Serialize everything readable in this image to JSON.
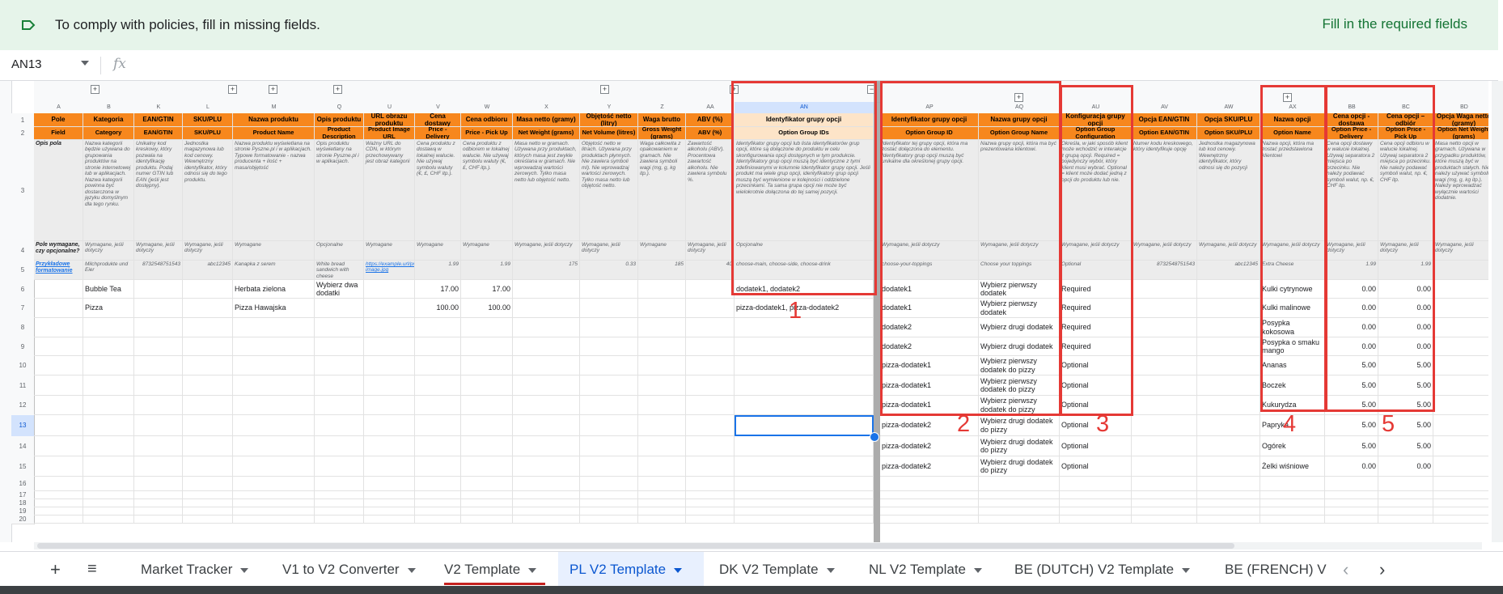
{
  "banner": {
    "message": "To comply with policies, fill in missing fields.",
    "action": "Fill in the required fields"
  },
  "formula_bar": {
    "cell_ref": "AN13",
    "fx": "fx"
  },
  "colors": {
    "header_orange": "#f7871d",
    "header_peach": "#fde4c8",
    "annotation_red": "#e53935",
    "selection_blue": "#1a73e8"
  },
  "row_numbers": [
    "1",
    "2",
    "3",
    "4",
    "5",
    "6",
    "7",
    "8",
    "9",
    "10",
    "11",
    "12",
    "13",
    "14",
    "15",
    "16",
    "17",
    "18",
    "19",
    "20"
  ],
  "columns": [
    {
      "letter": "A",
      "row1": "Pole",
      "row2": "Field",
      "row3": "Opis pola",
      "row4": "Pole wymagane, czy opcjonalne?",
      "row5": "Przykładowe formatowanie"
    },
    {
      "letter": "B",
      "row1": "Kategoria",
      "row2": "Category",
      "row3": "Nazwa kategorii będzie używana do grupowania produktów na stronie internetowej lub w aplikacjach. Nazwa kategorii powinna być dostarczona w języku domyślnym dla tego rynku.",
      "row4": "Wymagane, jeśli dotyczy",
      "row5": "Milchprodukte und Eier"
    },
    {
      "letter": "K",
      "row1": "EAN/GTIN",
      "row2": "EAN/GTIN",
      "row3": "Unikalny kod kreskowy, który pozwala na identyfikację produktu. Podaj numer GTIN lub EAN (jeśli jest dostępny).",
      "row4": "Wymagane, jeśli dotyczy",
      "row5": "8732548751543"
    },
    {
      "letter": "L",
      "row1": "SKU/PLU",
      "row2": "SKU/PLU",
      "row3": "Jednostka magazynowa lub kod cenowy. Wewnętrzny identyfikator, który odnosi się do tego produktu.",
      "row4": "Wymagane, jeśli dotyczy",
      "row5": "abc12345"
    },
    {
      "letter": "M",
      "row1": "Nazwa produktu",
      "row2": "Product Name",
      "row3": "Nazwa produktu wyświetlana na stronie Pyszne.pl i w aplikacjach. Typowe formatowanie - nazwa producenta + ilość + masa/objętość",
      "row4": "Wymagane",
      "row5": "Kanapka z serem"
    },
    {
      "letter": "Q",
      "row1": "Opis produktu",
      "row2": "Product Description",
      "row3": "Opis produktu wyświetlany na stronie Pyszne.pl i w aplikacjach.",
      "row4": "Opcjonalne",
      "row5": "White bread sandwich with cheese"
    },
    {
      "letter": "U",
      "row1": "URL obrazu produktu",
      "row2": "Product Image URL",
      "row3": "Ważny URL do CDN, w którym przechowywany jest obraz kategorii",
      "row4": "Wymagane",
      "row5": "https://example.url/product/product-image.jpg"
    },
    {
      "letter": "V",
      "row1": "Cena dostawy",
      "row2": "Price - Delivery",
      "row3": "Cena produktu z dostawą w lokalnej walucie. Nie używaj symbolu waluty (€, £, CHF itp.).",
      "row4": "Wymagane",
      "row5": "1.99"
    },
    {
      "letter": "W",
      "row1": "Cena odbioru",
      "row2": "Price - Pick Up",
      "row3": "Cena produktu z odbiorem w lokalnej walucie. Nie używaj symbolu waluty (€, £, CHF itp.).",
      "row4": "Wymagane",
      "row5": "1.99"
    },
    {
      "letter": "X",
      "row1": "Masa netto (gramy)",
      "row2": "Net Weight (grams)",
      "row3": "Masa netto w gramach. Używana przy produktach, których masa jest zwykle określana w gramach. Nie wprowadzaj wartości zerowych. Tylko masa netto lub objętość netto.",
      "row4": "Wymagane, jeśli dotyczy",
      "row5": "175"
    },
    {
      "letter": "Y",
      "row1": "Objętość netto (litry)",
      "row2": "Net Volume (litres)",
      "row3": "Objętość netto w litrach. Używana przy produktach płynnych. Nie zawiera symboli ml). Nie wprowadzaj wartości zerowych. Tylko masa netto lub objętość netto.",
      "row4": "Wymagane, jeśli dotyczy",
      "row5": "0.33"
    },
    {
      "letter": "Z",
      "row1": "Waga brutto",
      "row2": "Gross Weight (grams)",
      "row3": "Waga całkowita z opakowaniem w gramach. Nie zawiera symboli wagi (mg, g, kg itp.).",
      "row4": "Wymagane",
      "row5": "185"
    },
    {
      "letter": "AA",
      "row1": "ABV (%)",
      "row2": "ABV (%)",
      "row3": "Zawartość alkoholu (ABV). Procentowa zawartość alkoholu. Nie zawiera symbolu %.",
      "row4": "Wymagane, jeśli dotyczy",
      "row5": "40"
    },
    {
      "letter": "AN",
      "row1": "Identyfikator grupy opcji",
      "row2": "Option Group IDs",
      "row3": "Identyfikator grupy opcji lub listа identyfikatorów grup opcji, które są dołączone do produktu w celu skonfigurowania opcji dostępnych w tym produkcie. Identyfikatory grup opcji muszą być identyczne z tymi zdefiniowanymi w kolumnie Identyfikator grupy opcji. Jeśli produkt ma wiele grup opcji, identyfikatory grup opcji muszą być wymienione w kolejności i oddzielone przecinkami. Ta sama grupa opcji nie może być wielokrotnie dołączona do tej samej pozycji.",
      "row4": "Opcjonalne",
      "row5": "choose-main, choose-side, choose-drink"
    },
    {
      "letter": "AP",
      "row1": "Identyfikator grupy opcji",
      "row2": "Option Group ID",
      "row3": "Identyfikator tej grupy opcji, która ma zostać dołączona do elementu. Identyfikatory grup opcji muszą być unikalne dla określonej grupy opcji.",
      "row4": "Wymagane, jeśli dotyczy",
      "row5": "choose-your-toppings"
    },
    {
      "letter": "AQ",
      "row1": "Nazwa grupy opcji",
      "row2": "Option Group Name",
      "row3": "Nazwa grupy opcji, która ma być prezentowana klientowi.",
      "row4": "Wymagane, jeśli dotyczy",
      "row5": "Choose your toppings"
    },
    {
      "letter": "AU",
      "row1": "Konfiguracja grupy opcji",
      "row2": "Option Group Configuration",
      "row3": "Określa, w jaki sposób klient może wchodzić w interakcje z grupą opcji. Required = pojedynczy wybór, który klient musi wybrać. Optional = klient może dodać jedną z opcji do produktu lub nie.",
      "row4": "Wymagane, jeśli dotyczy",
      "row5": "Optional"
    },
    {
      "letter": "AV",
      "row1": "Opcja EAN/GTIN",
      "row2": "Option EAN/GTIN",
      "row3": "Numer kodu kreskowego, który identyfikuje opcję",
      "row4": "Wymagane, jeśli dotyczy",
      "row5": "8732548751543"
    },
    {
      "letter": "AW",
      "row1": "Opcja SKU/PLU",
      "row2": "Option SKU/PLU",
      "row3": "Jednostka magazynowa lub kod cenowy. Wewnętrzny identyfikator, który odnosi się do pozycji",
      "row4": "Wymagane, jeśli dotyczy",
      "row5": "abc12345"
    },
    {
      "letter": "AX",
      "row1": "Nazwa opcji",
      "row2": "Option Name",
      "row3": "Nazwa opcji, która ma zostać przedstawiona klientowi",
      "row4": "Wymagane, jeśli dotyczy",
      "row5": "Extra Cheese"
    },
    {
      "letter": "BB",
      "row1": "Cena opcji - dostawa",
      "row2": "Option Price - Delivery",
      "row3": "Cena opcji dostawy w walucie lokalnej. Używaj separatora 2 miejsca po przecinku. Nie należy podawać symboli walut, np. €, CHF itp.",
      "row4": "Wymagane, jeśli dotyczy",
      "row5": "1.99"
    },
    {
      "letter": "BC",
      "row1": "Cena opcji – odbiór",
      "row2": "Option Price - Pick Up",
      "row3": "Cena opcji odbioru w walucie lokalnej. Używaj separatora 2 miejsca po przecinku. Nie należy podawać symboli walut, np. €, CHF itp.",
      "row4": "Wymagane, jeśli dotyczy",
      "row5": "1.99"
    },
    {
      "letter": "BD",
      "row1": "Opcja Waga netto (gramy)",
      "row2": "Option Net Weight (grams)",
      "row3": "Masa netto opcji w gramach. Używana w przypadku produktów, które muszą być w produktach stałych. Nie należy używać symboli wagi (mg, g, kg itp.). Należy wprowadzać wyłącznie wartości dodatnie.",
      "row4": "Wymagane, jeśli dotyczy",
      "row5": ""
    }
  ],
  "products": [
    {
      "category": "Bubble Tea",
      "name": "Herbata zielona",
      "description": "Wybierz dwa dodatki",
      "price_delivery": "17.00",
      "price_pickup": "17.00",
      "option_group_ids": "dodatek1, dodatek2"
    },
    {
      "category": "Pizza",
      "name": "Pizza Hawajska",
      "description": "",
      "price_delivery": "100.00",
      "price_pickup": "100.00",
      "option_group_ids": "pizza-dodatek1, pizza-dodatek2"
    }
  ],
  "options": [
    {
      "group_id": "dodatek1",
      "group_name": "Wybierz pierwszy dodatek",
      "config": "Required",
      "name": "Kulki cytrynowe",
      "price_delivery": "0.00",
      "price_pickup": "0.00"
    },
    {
      "group_id": "dodatek1",
      "group_name": "Wybierz pierwszy dodatek",
      "config": "Required",
      "name": "Kulki malinowe",
      "price_delivery": "0.00",
      "price_pickup": "0.00"
    },
    {
      "group_id": "dodatek2",
      "group_name": "Wybierz drugi dodatek",
      "config": "Required",
      "name": "Posypka kokosowa",
      "price_delivery": "0.00",
      "price_pickup": "0.00"
    },
    {
      "group_id": "dodatek2",
      "group_name": "Wybierz drugi dodatek",
      "config": "Required",
      "name": "Posypka o smaku mango",
      "price_delivery": "0.00",
      "price_pickup": "0.00"
    },
    {
      "group_id": "pizza-dodatek1",
      "group_name": "Wybierz pierwszy dodatek do pizzy",
      "config": "Optional",
      "name": "Ananas",
      "price_delivery": "5.00",
      "price_pickup": "5.00"
    },
    {
      "group_id": "pizza-dodatek1",
      "group_name": "Wybierz pierwszy dodatek do pizzy",
      "config": "Optional",
      "name": "Boczek",
      "price_delivery": "5.00",
      "price_pickup": "5.00"
    },
    {
      "group_id": "pizza-dodatek1",
      "group_name": "Wybierz pierwszy dodatek do pizzy",
      "config": "Optional",
      "name": "Kukurydza",
      "price_delivery": "5.00",
      "price_pickup": "5.00"
    },
    {
      "group_id": "pizza-dodatek2",
      "group_name": "Wybierz drugi dodatek do pizzy",
      "config": "Optional",
      "name": "Papryka",
      "price_delivery": "5.00",
      "price_pickup": "5.00"
    },
    {
      "group_id": "pizza-dodatek2",
      "group_name": "Wybierz drugi dodatek do pizzy",
      "config": "Optional",
      "name": "Ogórek",
      "price_delivery": "5.00",
      "price_pickup": "5.00"
    },
    {
      "group_id": "pizza-dodatek2",
      "group_name": "Wybierz drugi dodatek do pizzy",
      "config": "Optional",
      "name": "Żelki wiśniowe",
      "price_delivery": "0.00",
      "price_pickup": "0.00"
    }
  ],
  "annotations": [
    "1",
    "2",
    "3",
    "4",
    "5"
  ],
  "tabs": [
    {
      "label": "Market Tracker"
    },
    {
      "label": "V1 to V2 Converter"
    },
    {
      "label": "V2 Template"
    },
    {
      "label": "PL V2 Template",
      "active": true
    },
    {
      "label": "DK V2 Template"
    },
    {
      "label": "NL V2 Template"
    },
    {
      "label": "BE (DUTCH) V2 Template"
    },
    {
      "label": "BE (FRENCH) V"
    }
  ],
  "tab_controls": {
    "add": "+",
    "menu": "≡",
    "prev": "‹",
    "next": "›"
  }
}
